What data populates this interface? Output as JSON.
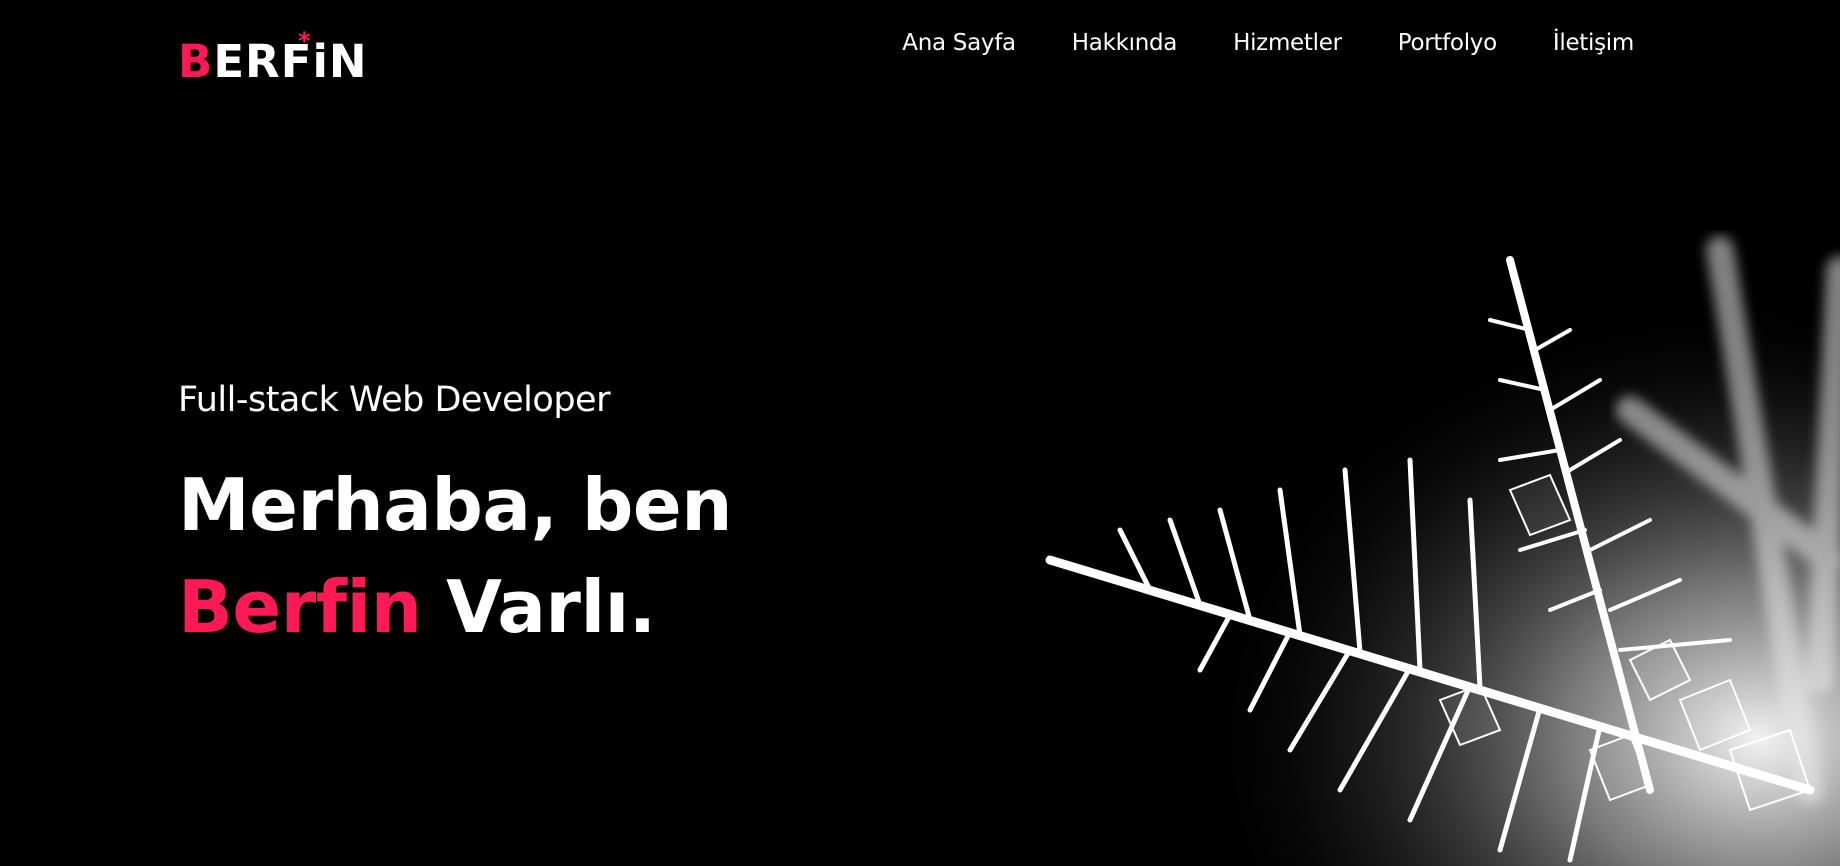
{
  "brand": {
    "logo_first": "B",
    "logo_rest": "ERFiN",
    "logo_star": "*",
    "accent_color": "#ff1a55"
  },
  "nav": {
    "items": [
      "Ana Sayfa",
      "Hakkında",
      "Hizmetler",
      "Portfolyo",
      "İletişim"
    ]
  },
  "hero": {
    "subtitle": "Full-stack Web Developer",
    "line1": "Merhaba, ben",
    "name": "Berfin",
    "surname": "Varlı."
  }
}
